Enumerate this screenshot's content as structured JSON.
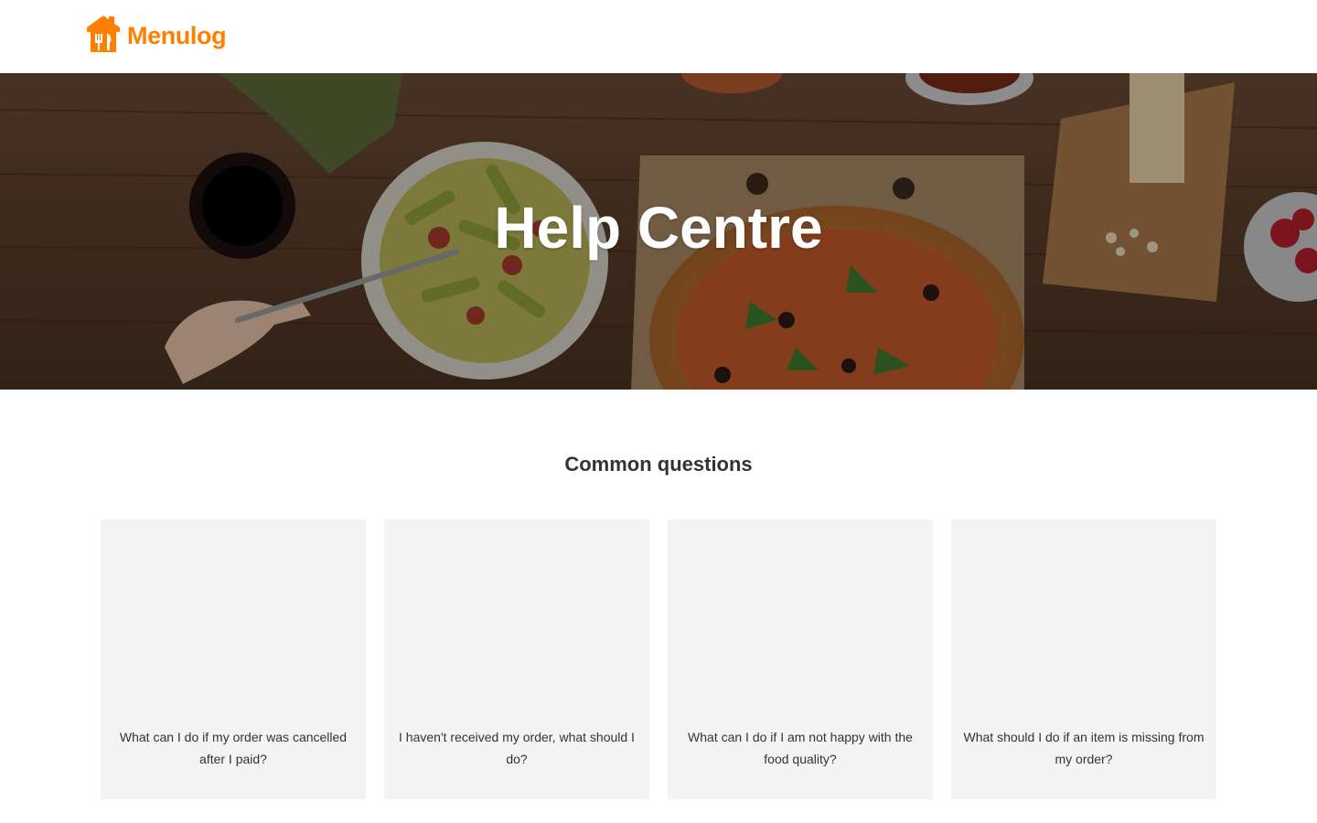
{
  "header": {
    "logo_text": "Menulog",
    "logo_icon": "chef-hat-icon",
    "brand_color": "#ff8000"
  },
  "hero": {
    "title": "Help Centre",
    "background": "food-table-photo"
  },
  "common_questions": {
    "title": "Common questions",
    "cards": [
      {
        "label": "What can I do if my order was cancelled after I paid?"
      },
      {
        "label": "I haven't received my order, what should I do?"
      },
      {
        "label": "What can I do if I am not happy with the food quality?"
      },
      {
        "label": "What should I do if an item is missing from my order?"
      }
    ]
  }
}
